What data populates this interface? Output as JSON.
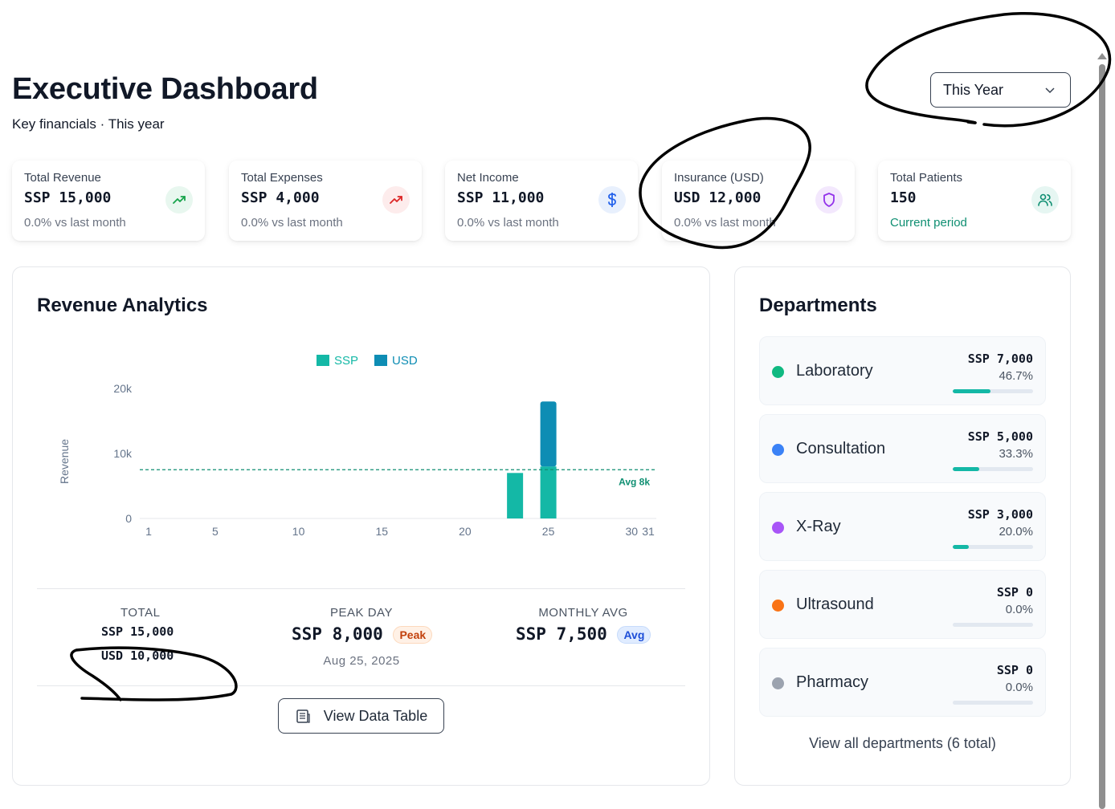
{
  "header": {
    "title": "Executive Dashboard",
    "subtitle": "Key financials · This year",
    "period_select": "This Year"
  },
  "kpis": [
    {
      "label": "Total Revenue",
      "value": "SSP 15,000",
      "sub": "0.0% vs last month",
      "icon": "trending-up-icon",
      "color": "#16a34a",
      "bg": "#e8f7ef"
    },
    {
      "label": "Total Expenses",
      "value": "SSP 4,000",
      "sub": "0.0% vs last month",
      "icon": "trending-up-icon",
      "color": "#dc2626",
      "bg": "#fdecec"
    },
    {
      "label": "Net Income",
      "value": "SSP 11,000",
      "sub": "0.0% vs last month",
      "icon": "dollar-icon",
      "color": "#2563eb",
      "bg": "#e8f0fd"
    },
    {
      "label": "Insurance (USD)",
      "value": "USD 12,000",
      "sub": "0.0% vs last month",
      "icon": "shield-icon",
      "color": "#9333ea",
      "bg": "#f3e8fd"
    },
    {
      "label": "Total Patients",
      "value": "150",
      "sub": "Current period",
      "icon": "users-icon",
      "color": "#0f8f72",
      "bg": "#e6f6f2"
    }
  ],
  "revenue": {
    "title": "Revenue Analytics",
    "summary": {
      "total_label": "TOTAL",
      "total_ssp": "SSP 15,000",
      "total_usd": "USD 10,000",
      "peak_label": "PEAK DAY",
      "peak_value": "SSP 8,000",
      "peak_badge": "Peak",
      "peak_date": "Aug 25, 2025",
      "avg_label": "MONTHLY AVG",
      "avg_value": "SSP 7,500",
      "avg_badge": "Avg"
    },
    "view_table_label": "View Data Table"
  },
  "chart_data": {
    "type": "bar",
    "stacked": true,
    "x": [
      23,
      25
    ],
    "x_ticks": [
      "1",
      "5",
      "10",
      "15",
      "20",
      "25",
      "30",
      "31"
    ],
    "x_tick_values": [
      1,
      5,
      10,
      15,
      20,
      25,
      30,
      31
    ],
    "xlim": [
      1,
      31
    ],
    "series": [
      {
        "name": "SSP",
        "values": [
          7000,
          8000
        ],
        "color": "#14b8a6"
      },
      {
        "name": "USD",
        "values": [
          0,
          10000
        ],
        "color": "#0e8db4"
      }
    ],
    "ylabel": "Revenue",
    "y_ticks": [
      "0",
      "10k",
      "20k"
    ],
    "y_tick_values": [
      0,
      10000,
      20000
    ],
    "ylim": [
      0,
      20000
    ],
    "avg_line": {
      "value": 7500,
      "label": "Avg 8k"
    },
    "legend_position": "top-center",
    "grid": false
  },
  "departments": {
    "title": "Departments",
    "items": [
      {
        "name": "Laboratory",
        "amount": "SSP 7,000",
        "pct": "46.7%",
        "share": 0.467,
        "color": "#10b981"
      },
      {
        "name": "Consultation",
        "amount": "SSP 5,000",
        "pct": "33.3%",
        "share": 0.333,
        "color": "#3b82f6"
      },
      {
        "name": "X-Ray",
        "amount": "SSP 3,000",
        "pct": "20.0%",
        "share": 0.2,
        "color": "#a855f7"
      },
      {
        "name": "Ultrasound",
        "amount": "SSP 0",
        "pct": "0.0%",
        "share": 0,
        "color": "#f97316"
      },
      {
        "name": "Pharmacy",
        "amount": "SSP 0",
        "pct": "0.0%",
        "share": 0,
        "color": "#9ca3af"
      }
    ],
    "view_all": "View all departments (6 total)"
  },
  "colors": {
    "accent": "#14b8a6",
    "usd": "#0e8db4",
    "annotation_ink": "#000000"
  }
}
